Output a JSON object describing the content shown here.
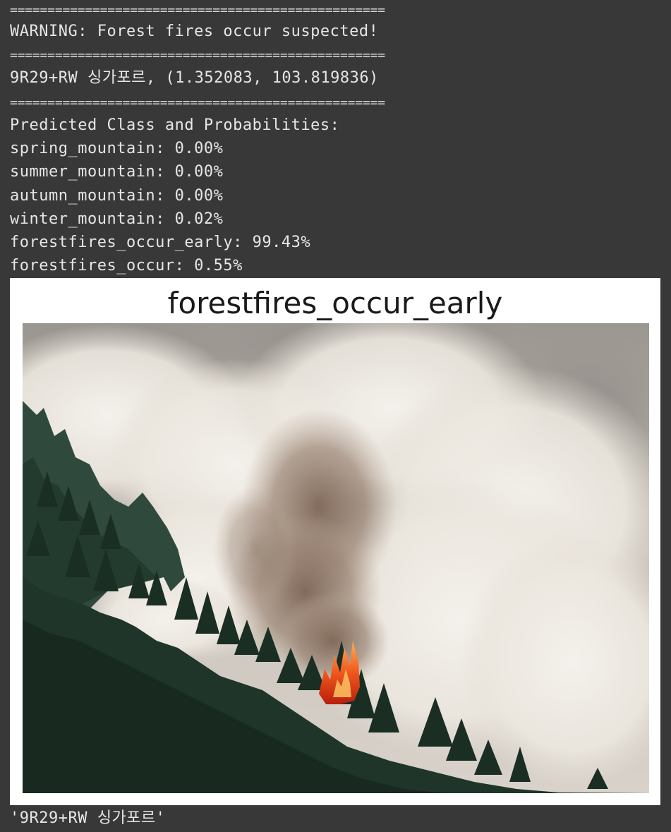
{
  "output": {
    "separator": "==================================================",
    "warning": "WARNING: Forest fires occur suspected!",
    "location": "9R29+RW 싱가포르, (1.352083, 103.819836)",
    "probabilities_header": "Predicted Class and Probabilities:",
    "probabilities": [
      "spring_mountain: 0.00%",
      "summer_mountain: 0.00%",
      "autumn_mountain: 0.00%",
      "winter_mountain: 0.02%",
      "forestfires_occur_early: 99.43%",
      "forestfires_occur: 0.55%"
    ],
    "return_value": "'9R29+RW 싱가포르'"
  },
  "figure": {
    "title": "forestfires_occur_early",
    "image_subject": "forest-fire-smoke-photo"
  },
  "colors": {
    "background": "#383838",
    "text": "#e6e6e6",
    "figure_bg": "#ffffff",
    "flame": "#e8491d"
  }
}
